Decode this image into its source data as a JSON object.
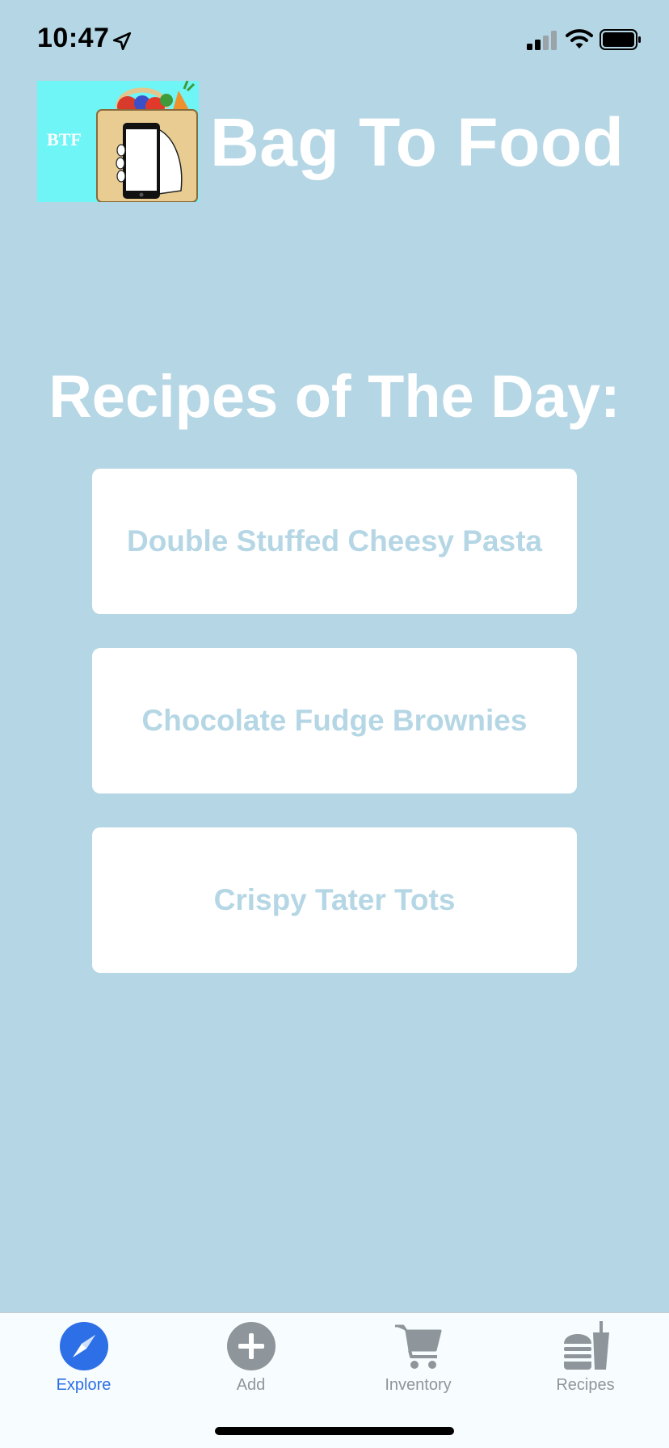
{
  "status": {
    "time": "10:47"
  },
  "header": {
    "logo_text": "BTF",
    "title": "Bag To Food"
  },
  "main": {
    "heading": "Recipes of The Day:",
    "recipes": [
      {
        "label": "Double Stuffed Cheesy Pasta"
      },
      {
        "label": "Chocolate Fudge Brownies"
      },
      {
        "label": "Crispy Tater Tots"
      }
    ]
  },
  "tabbar": {
    "items": [
      {
        "label": "Explore",
        "icon": "compass-icon",
        "active": true
      },
      {
        "label": "Add",
        "icon": "plus-circle-icon",
        "active": false
      },
      {
        "label": "Inventory",
        "icon": "cart-icon",
        "active": false
      },
      {
        "label": "Recipes",
        "icon": "burger-drink-icon",
        "active": false
      }
    ]
  },
  "colors": {
    "background": "#b5d6e4",
    "accent": "#2d6fe6",
    "inactive": "#8e969b",
    "card": "#ffffff"
  }
}
